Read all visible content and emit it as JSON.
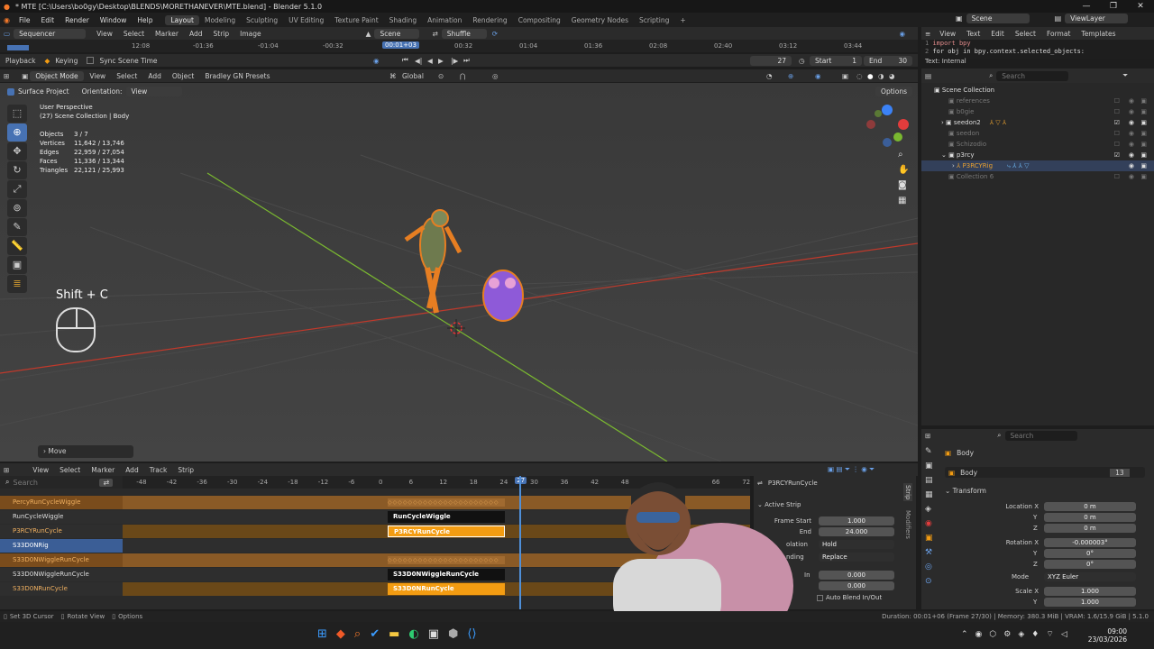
{
  "window": {
    "title": "* MTE [C:\\Users\\bo0gy\\Desktop\\BLENDS\\MORETHANEVER\\MTE.blend] - Blender 5.1.0",
    "minimize": "—",
    "maximize": "❐",
    "close": "✕"
  },
  "menu": {
    "items": [
      "File",
      "Edit",
      "Render",
      "Window",
      "Help"
    ],
    "workspaces": [
      "Layout",
      "Modeling",
      "Sculpting",
      "UV Editing",
      "Texture Paint",
      "Shading",
      "Animation",
      "Rendering",
      "Compositing",
      "Geometry Nodes",
      "Scripting"
    ],
    "active_workspace": "Layout",
    "add_workspace": "+",
    "scene_label": "Scene",
    "viewlayer_label": "ViewLayer"
  },
  "sequencer": {
    "editor": "Sequencer",
    "menus": [
      "View",
      "Select",
      "Marker",
      "Add",
      "Strip",
      "Image"
    ],
    "scene": "Scene",
    "shuffle": "Shuffle",
    "ruler": [
      "12:08",
      "-01:36",
      "-01:04",
      "-00:32",
      "00:01+03",
      "00:32",
      "01:04",
      "01:36",
      "02:08",
      "02:40",
      "03:12",
      "03:44"
    ],
    "current_time": "00:01+03"
  },
  "timeline": {
    "playback": "Playback",
    "keying": "Keying",
    "sync": "Sync Scene Time",
    "frame": "27",
    "start_label": "Start",
    "start": "1",
    "end_label": "End",
    "end": "30"
  },
  "text_editor": {
    "menus": [
      "View",
      "Text",
      "Edit",
      "Select",
      "Format",
      "Templates"
    ],
    "line1": "import bpy",
    "line2": "for obj in bpy.context.selected_objects:",
    "status": "Text: Internal"
  },
  "viewport": {
    "mode": "Object Mode",
    "menus": [
      "View",
      "Select",
      "Add",
      "Object",
      "Bradley GN Presets"
    ],
    "transform": "Global",
    "surface_project": "Surface Project",
    "orientation_label": "Orientation:",
    "orientation": "View",
    "options": "Options",
    "perspective": "User Perspective",
    "collection": "(27) Scene Collection | Body",
    "stats": [
      {
        "k": "Objects",
        "v": "3 / 7"
      },
      {
        "k": "Vertices",
        "v": "11,642 / 13,746"
      },
      {
        "k": "Edges",
        "v": "22,959 / 27,054"
      },
      {
        "k": "Faces",
        "v": "11,336 / 13,344"
      },
      {
        "k": "Triangles",
        "v": "22,121 / 25,993"
      }
    ],
    "shortcut": "Shift + C",
    "last_op": "Move"
  },
  "outliner": {
    "search": "Search",
    "root": "Scene Collection",
    "items": [
      {
        "name": "references",
        "dim": true
      },
      {
        "name": "b0gie",
        "dim": true
      },
      {
        "name": "seedon2",
        "dim": false
      },
      {
        "name": "seedon",
        "dim": true
      },
      {
        "name": "Schizodio",
        "dim": true
      },
      {
        "name": "p3rcy",
        "dim": false
      },
      {
        "name": "P3RCYRig",
        "dim": false,
        "rig": true
      },
      {
        "name": "Collection 6",
        "dim": true
      }
    ]
  },
  "nla": {
    "menus": [
      "View",
      "Select",
      "Marker",
      "Add",
      "Track",
      "Strip"
    ],
    "search": "Search",
    "ruler": [
      "-48",
      "-42",
      "-36",
      "-30",
      "-24",
      "-18",
      "-12",
      "-6",
      "0",
      "6",
      "12",
      "18",
      "24",
      "27",
      "30",
      "36",
      "42",
      "48",
      "66",
      "72"
    ],
    "current_frame": "27",
    "tracks": [
      {
        "name": "PercyRunCycleWiggle",
        "type": "action"
      },
      {
        "name": "RunCycleWiggle",
        "type": "track"
      },
      {
        "name": "P3RCYRunCycle",
        "type": "track"
      },
      {
        "name": "S33D0NRig",
        "type": "object"
      },
      {
        "name": "S33D0NWiggleRunCycle",
        "type": "action"
      },
      {
        "name": "S33D0NWiggleRunCycle",
        "type": "track"
      },
      {
        "name": "S33D0NRunCycle",
        "type": "track"
      }
    ],
    "strips": {
      "s1": "RunCycleWiggle",
      "s2": "P3RCYRunCycle",
      "s3": "S33D0NWiggleRunCycle",
      "s4": "S33D0NRunCycle"
    }
  },
  "nla_sidebar": {
    "strip_name": "P3RCYRunCycle",
    "panel": "Active Strip",
    "frame_start_label": "Frame Start",
    "frame_start": "1.000",
    "end_label": "End",
    "end": "24.000",
    "extrapolation_label": "olation",
    "extrapolation": "Hold",
    "blending_label": "nding",
    "blending": "Replace",
    "blend_in_label": "In",
    "blend_in": "0.000",
    "blend_out": "0.000",
    "auto_blend": "Auto Blend In/Out",
    "tabs": [
      "Strip",
      "Modifiers"
    ]
  },
  "properties": {
    "search": "Search",
    "object": "Body",
    "data": "Body",
    "users": "13",
    "transform": "Transform",
    "location_label": "Location X",
    "loc": [
      "0 m",
      "0 m",
      "0 m"
    ],
    "rotation_label": "Rotation X",
    "rot": [
      "-0.000003°",
      "0°",
      "0°"
    ],
    "mode_label": "Mode",
    "mode": "XYZ Euler",
    "scale_label": "Scale X",
    "scale": [
      "1.000",
      "1.000"
    ],
    "y": "Y",
    "z": "Z"
  },
  "status": {
    "left1": "Set 3D Cursor",
    "left2": "Rotate View",
    "left3": "Options",
    "right": "Duration: 00:01+06 (Frame 27/30) | Memory: 380.3 MiB | VRAM: 1.6/15.9 GiB | 5.1.0"
  },
  "taskbar": {
    "time": "09:00",
    "date": "23/03/2026"
  },
  "colors": {
    "accent": "#4772b3",
    "strip_orange": "#f39c12",
    "playhead": "#4f8fd8"
  }
}
